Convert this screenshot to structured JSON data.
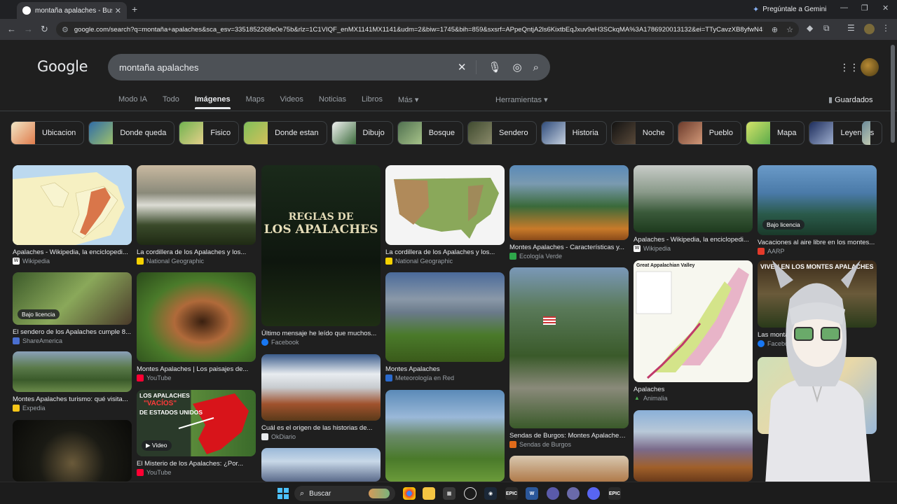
{
  "browser": {
    "tab_title": "montaña apalaches - Buscar co",
    "gemini_label": "Pregúntale a Gemini",
    "url": "google.com/search?q=montaña+apalaches&sca_esv=3351852268e0e75b&rlz=1C1VIQF_enMX1141MX1141&udm=2&biw=1745&bih=859&sxsrf=APpeQntjA2ls6KixtbEqJxuv9eH3SCkqMA%3A1786920013132&ei=TTyCavzXB8yfwN4P8Ke..."
  },
  "google": {
    "logo": "Google",
    "query": "montaña apalaches",
    "tabs": [
      "Modo IA",
      "Todo",
      "Imágenes",
      "Maps",
      "Videos",
      "Noticias",
      "Libros",
      "Más"
    ],
    "active_tab": "Imágenes",
    "tools": "Herramientas",
    "saved": "Guardados"
  },
  "chips": [
    {
      "label": "Ubicacion",
      "c1": "#f1e9c9",
      "c2": "#e07a4a"
    },
    {
      "label": "Donde queda",
      "c1": "#2e6ba8",
      "c2": "#9fc26a"
    },
    {
      "label": "Fisico",
      "c1": "#6fb24f",
      "c2": "#e6d08a"
    },
    {
      "label": "Donde estan",
      "c1": "#7fbf5a",
      "c2": "#d4c15a"
    },
    {
      "label": "Dibujo",
      "c1": "#f5f5f5",
      "c2": "#3a6a3a"
    },
    {
      "label": "Bosque",
      "c1": "#4f6f4f",
      "c2": "#a8c48a"
    },
    {
      "label": "Sendero",
      "c1": "#3f4a2f",
      "c2": "#8a8a6a"
    },
    {
      "label": "Historia",
      "c1": "#2d4a7a",
      "c2": "#c7d2e0"
    },
    {
      "label": "Noche",
      "c1": "#111111",
      "c2": "#5a4a3a"
    },
    {
      "label": "Pueblo",
      "c1": "#6a3a2a",
      "c2": "#d49a7a"
    },
    {
      "label": "Mapa",
      "c1": "#d6e46a",
      "c2": "#5aaa4a"
    },
    {
      "label": "Leyendas",
      "c1": "#1a2a5a",
      "c2": "#a0b0d0"
    }
  ],
  "results": {
    "c1": [
      {
        "caption": "Apalaches - Wikipedia, la enciclopedi...",
        "source": "Wikipedia"
      },
      {
        "caption": "El sendero de los Apalaches cumple 8...",
        "source": "ShareAmerica",
        "badge": "Bajo licencia"
      },
      {
        "caption": "Montes Apalaches turismo: qué visita...",
        "source": "Expedia"
      },
      {
        "caption": "",
        "source": ""
      }
    ],
    "c2": [
      {
        "caption": "La cordillera de los Apalaches y los...",
        "source": "National Geographic"
      },
      {
        "caption": "Montes Apalaches | Los paisajes de...",
        "source": "YouTube"
      },
      {
        "caption": "El Misterio de los Apalaches: ¿Por...",
        "source": "YouTube",
        "badge": "Video",
        "overlay1": "LOS APALACHES",
        "overlay2": "\"VACÍOS\"",
        "overlay3": "DE ESTADOS UNIDOS"
      }
    ],
    "c3": [
      {
        "caption": "Último mensaje he leído que muchos...",
        "source": "Facebook",
        "overlay1": "REGLAS DE",
        "overlay2": "LOS APALACHES"
      },
      {
        "caption": "Cuál es el origen de las historias de...",
        "source": "OkDiario"
      },
      {
        "caption": "",
        "source": ""
      }
    ],
    "c4": [
      {
        "caption": "La cordillera de los Apalaches y los...",
        "source": "National Geographic"
      },
      {
        "caption": "Montes Apalaches",
        "source": "Meteorología en Red"
      },
      {
        "caption": "",
        "source": ""
      }
    ],
    "c5": [
      {
        "caption": "Montes Apalaches - Características y...",
        "source": "Ecología Verde"
      },
      {
        "caption": "Sendas de Burgos: Montes Apalaches:...",
        "source": "Sendas de Burgos"
      },
      {
        "caption": "",
        "source": ""
      }
    ],
    "c6": [
      {
        "caption": "Apalaches - Wikipedia, la enciclopedi...",
        "source": "Wikipedia"
      },
      {
        "caption": "Apalaches",
        "source": "Animalia",
        "overlay1": "Great Appalachian Valley"
      },
      {
        "caption": "",
        "source": ""
      }
    ],
    "c7": [
      {
        "caption": "Vacaciones al aire libre en los montes...",
        "source": "AARP",
        "badge": "Bajo licencia"
      },
      {
        "caption": "Las monta... tillone...",
        "source": "Facebo",
        "overlay1": "VIVEN EN LOS MONTES APALACHES"
      },
      {
        "caption": "",
        "source": ""
      }
    ]
  },
  "taskbar": {
    "search_label": "Buscar",
    "apps": [
      "chrome",
      "files",
      "store",
      "github",
      "steam",
      "epic",
      "word",
      "app",
      "settings",
      "discord",
      "epic2"
    ]
  },
  "colors": {
    "background": "#1f1f1f",
    "searchbox": "#4d5156",
    "text": "#e8eaed",
    "muted": "#9aa0a6"
  }
}
